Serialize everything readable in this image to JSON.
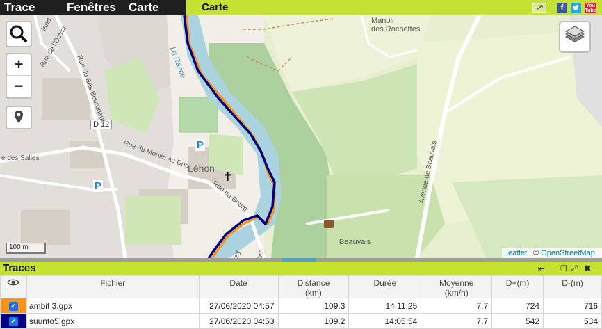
{
  "menu": {
    "trace": "Trace",
    "fenetres": "Fenêtres",
    "carte": "Carte"
  },
  "panel_title": "Carte",
  "social": {
    "facebook": "f",
    "youtube_top": "You",
    "youtube_bottom": "Tube"
  },
  "map": {
    "zoom_in": "+",
    "zoom_out": "−",
    "scale": "100 m",
    "attribution": {
      "leaflet": "Leaflet",
      "sep": " | © ",
      "osm": "OpenStreetMap"
    },
    "labels": {
      "manoir_1": "Manoir",
      "manoir_2": "des Rochettes",
      "lehon": "Léhon",
      "beauvais": "Beauvais",
      "d12": "D 12",
      "la_rance": "La Rance",
      "rue_bas_bourgneuf": "Rue du Bas Bourgneuf",
      "rue_octroi": "Rue de l'Octroi",
      "rue_moulin_duc": "Rue du Moulin au Duc",
      "rue_bourg": "Rue du Bourg",
      "av_beauvais": "Avenue de Beauvais",
      "rue_salles": "e des Salles",
      "parking": "P",
      "land": "land",
      "bre": "bre",
      "ay": "ay"
    }
  },
  "traces_panel": {
    "title": "Traces",
    "columns": [
      "Fichier",
      "Date",
      "Distance\n(km)",
      "Durée",
      "Moyenne\n(km/h)",
      "D+(m)",
      "D-(m)"
    ],
    "column_labels": {
      "fichier": "Fichier",
      "date": "Date",
      "distance": "Distance",
      "distance_unit": "(km)",
      "duree": "Durée",
      "moyenne": "Moyenne",
      "moyenne_unit": "(km/h)",
      "dplus": "D+(m)",
      "dminus": "D-(m)"
    },
    "rows": [
      {
        "color": "#f7941d",
        "checked": true,
        "file": "ambit 3.gpx",
        "date": "27/06/2020 04:57",
        "distance": "109.3",
        "duration": "14:11:25",
        "average": "7.7",
        "dplus": "724",
        "dminus": "716"
      },
      {
        "color": "#000080",
        "checked": true,
        "file": "suunto5.gpx",
        "date": "27/06/2020 04:53",
        "distance": "109.2",
        "duration": "14:05:54",
        "average": "7.7",
        "dplus": "542",
        "dminus": "534"
      }
    ]
  },
  "colors": {
    "accent": "#c5e233",
    "menu_bg": "#1f1f1f",
    "track_orange": "#f7941d",
    "track_navy": "#000080",
    "river": "#aad3df",
    "forest": "#add19e"
  }
}
